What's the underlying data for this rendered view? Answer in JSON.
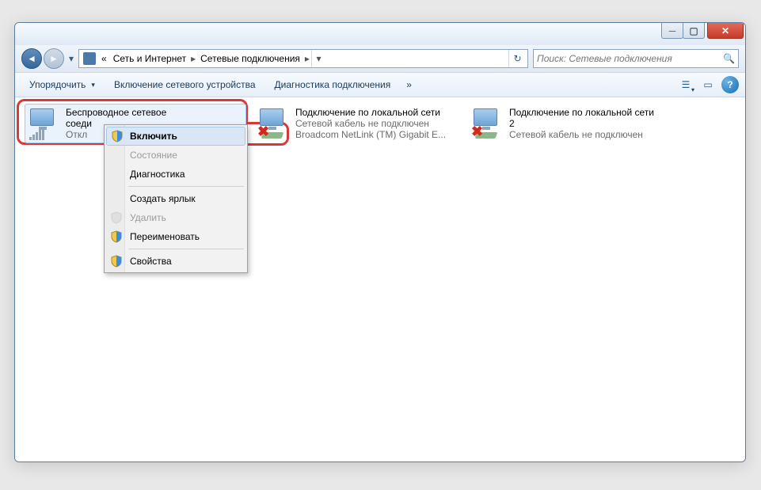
{
  "titlebar": {
    "min": "─",
    "max": "▢",
    "close": "✕"
  },
  "nav": {
    "back_glyph": "◄",
    "fwd_glyph": "►",
    "drop_glyph": "▾",
    "prefix": "«",
    "seg1": "Сеть и Интернет",
    "seg2": "Сетевые подключения",
    "chev": "▸",
    "refresh": "↻",
    "search_placeholder": "Поиск: Сетевые подключения",
    "search_glyph": "🔍"
  },
  "toolbar": {
    "organize": "Упорядочить",
    "enable_device": "Включение сетевого устройства",
    "diagnose": "Диагностика подключения",
    "chev": "»",
    "view_glyph": "☰",
    "pane_glyph": "▭",
    "help_glyph": "?"
  },
  "items": [
    {
      "title": "Беспроводное сетевое",
      "line2": "соеди",
      "line3": "Откл"
    },
    {
      "title": "Подключение по локальной сети",
      "line2": "Сетевой кабель не подключен",
      "line3": "Broadcom NetLink (TM) Gigabit E..."
    },
    {
      "title": "Подключение по локальной сети",
      "line2": "2",
      "line3": "Сетевой кабель не подключен"
    }
  ],
  "context_menu": {
    "enable": "Включить",
    "status": "Состояние",
    "diagnostics": "Диагностика",
    "shortcut": "Создать ярлык",
    "delete": "Удалить",
    "rename": "Переименовать",
    "properties": "Свойства"
  }
}
